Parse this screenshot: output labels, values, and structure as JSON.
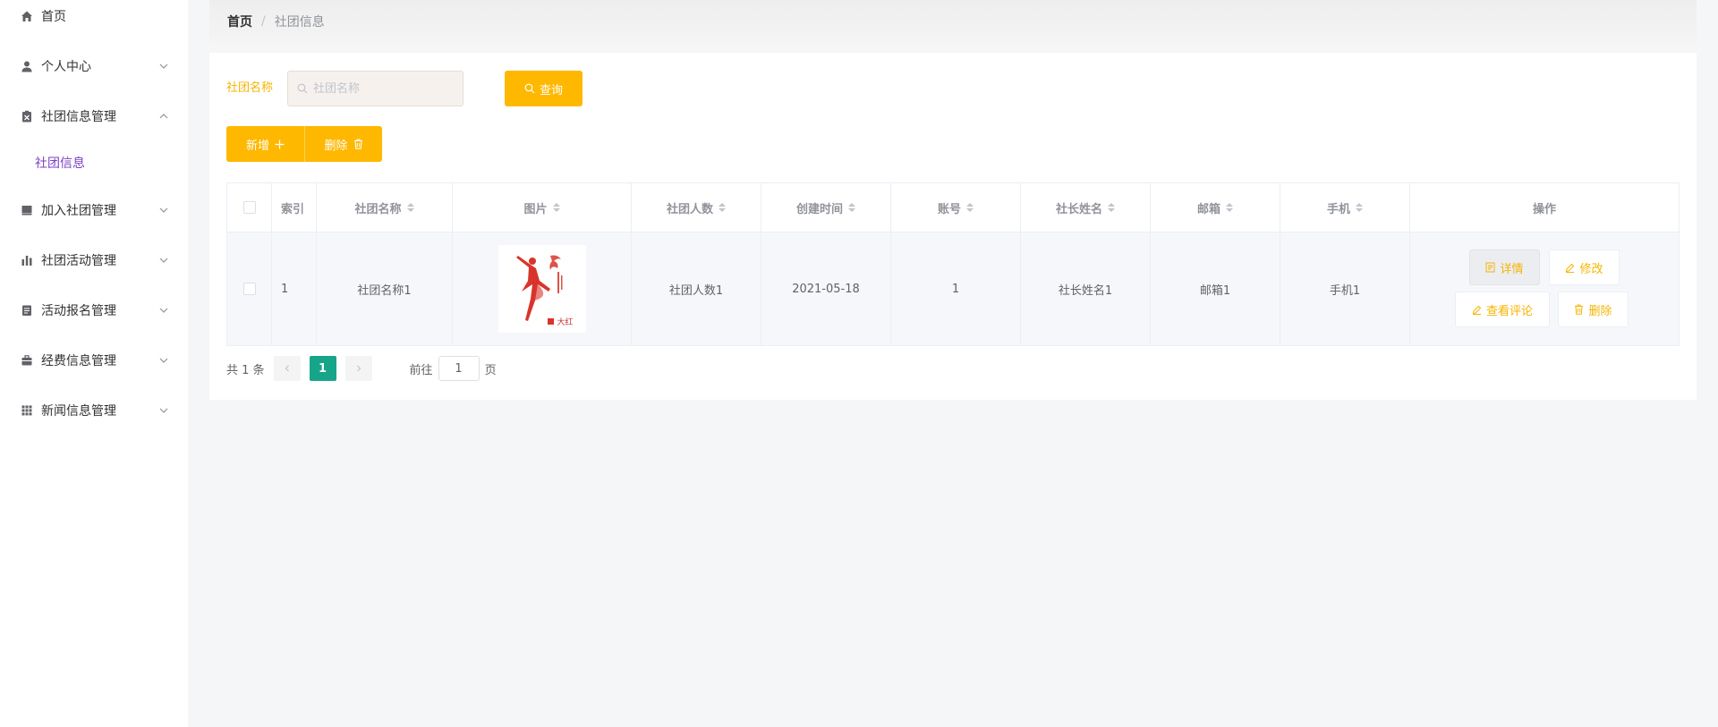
{
  "sidebar": {
    "items": [
      {
        "label": "首页",
        "icon": "home-icon"
      },
      {
        "label": "个人中心",
        "icon": "user-icon"
      },
      {
        "label": "社团信息管理",
        "icon": "clipboard-icon"
      },
      {
        "label": "加入社团管理",
        "icon": "folder-icon"
      },
      {
        "label": "社团活动管理",
        "icon": "bar-chart-icon"
      },
      {
        "label": "活动报名管理",
        "icon": "document-icon"
      },
      {
        "label": "经费信息管理",
        "icon": "briefcase-icon"
      },
      {
        "label": "新闻信息管理",
        "icon": "grid-icon"
      }
    ],
    "active_sub": "社团信息",
    "accent_color": "#7b3fc4"
  },
  "breadcrumb": {
    "home": "首页",
    "separator": "/",
    "current": "社团信息"
  },
  "search": {
    "label": "社团名称",
    "placeholder": "社团名称",
    "value": "",
    "button": "查询"
  },
  "actions": {
    "add": "新增",
    "delete": "删除"
  },
  "table": {
    "headers": [
      "索引",
      "社团名称",
      "图片",
      "社团人数",
      "创建时间",
      "账号",
      "社长姓名",
      "邮箱",
      "手机",
      "操作"
    ],
    "rows": [
      {
        "index": "1",
        "name": "社团名称1",
        "image_tag": "大红",
        "members": "社团人数1",
        "created": "2021-05-18",
        "account": "1",
        "president": "社长姓名1",
        "email": "邮箱1",
        "phone": "手机1",
        "ops": {
          "detail": "详情",
          "edit": "修改",
          "comments": "查看评论",
          "delete": "删除"
        }
      }
    ]
  },
  "pagination": {
    "total": "共 1 条",
    "current_page": "1",
    "goto_label": "前往",
    "goto_value": "1",
    "page_unit": "页"
  },
  "colors": {
    "primary": "#ffb800",
    "pager_active": "#16a589"
  }
}
